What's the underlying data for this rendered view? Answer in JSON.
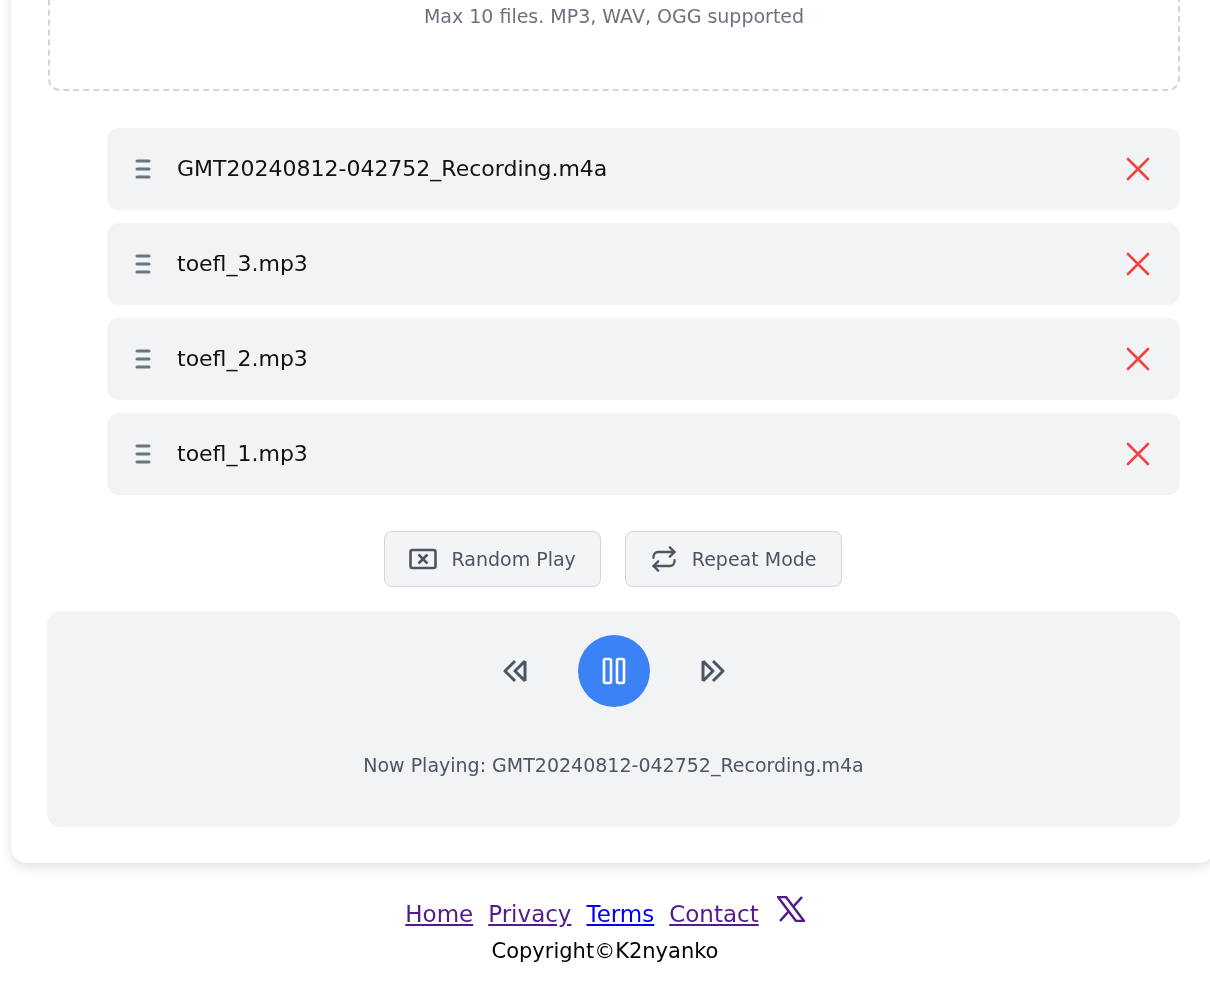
{
  "dropzone": {
    "hint": "Max 10 files. MP3, WAV, OGG supported"
  },
  "playlist": [
    {
      "name": "GMT20240812-042752_Recording.m4a"
    },
    {
      "name": "toefl_3.mp3"
    },
    {
      "name": "toefl_2.mp3"
    },
    {
      "name": "toefl_1.mp3"
    }
  ],
  "modes": [
    {
      "kind": "shuffle",
      "label": "Random Play",
      "active": false
    },
    {
      "kind": "repeat",
      "label": "Repeat Mode",
      "active": false
    }
  ],
  "player": {
    "playing": true,
    "now_playing": "Now Playing: GMT20240812-042752_Recording.m4a"
  },
  "footer": {
    "links": [
      {
        "label": "Home",
        "visited": true
      },
      {
        "label": "Privacy",
        "visited": true
      },
      {
        "label": "Terms",
        "visited": false
      },
      {
        "label": "Contact",
        "visited": true
      }
    ],
    "copyright": "Copyright©K2nyanko"
  }
}
